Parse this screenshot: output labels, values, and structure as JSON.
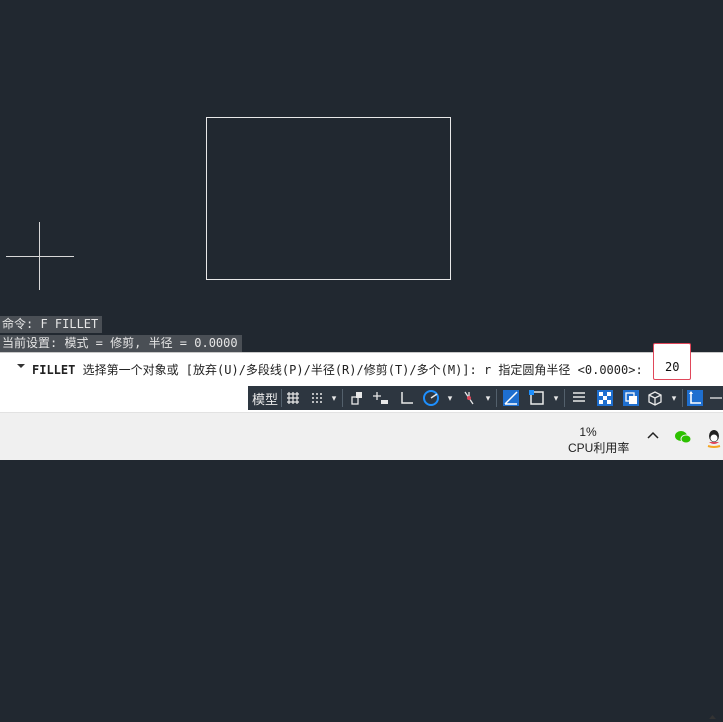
{
  "history": {
    "line1": "命令: F FILLET",
    "line2": "当前设置: 模式 = 修剪, 半径 = 0.0000"
  },
  "command": {
    "name": "FILLET",
    "prompt": " 选择第一个对象或 [放弃(U)/多段线(P)/半径(R)/修剪(T)/多个(M)]: r 指定圆角半径 <0.0000>:",
    "input_value": "20"
  },
  "status": {
    "model_label": "模型",
    "icons": [
      "grid-icon",
      "snap-icon",
      "infer-constraints-icon",
      "dynamic-input-icon",
      "ortho-icon",
      "polar-icon",
      "isodraft-icon",
      "object-snap-tracking-icon",
      "object-snap-icon",
      "lineweight-icon",
      "transparency-icon",
      "selection-cycling-icon",
      "3d-osnap-icon",
      "dynamic-ucs-icon"
    ]
  },
  "tray": {
    "cpu_percent": "1%",
    "cpu_label": "CPU利用率"
  },
  "colors": {
    "canvas": "#212830",
    "highlight": "#e0475a",
    "accent_blue": "#1e90ff"
  }
}
